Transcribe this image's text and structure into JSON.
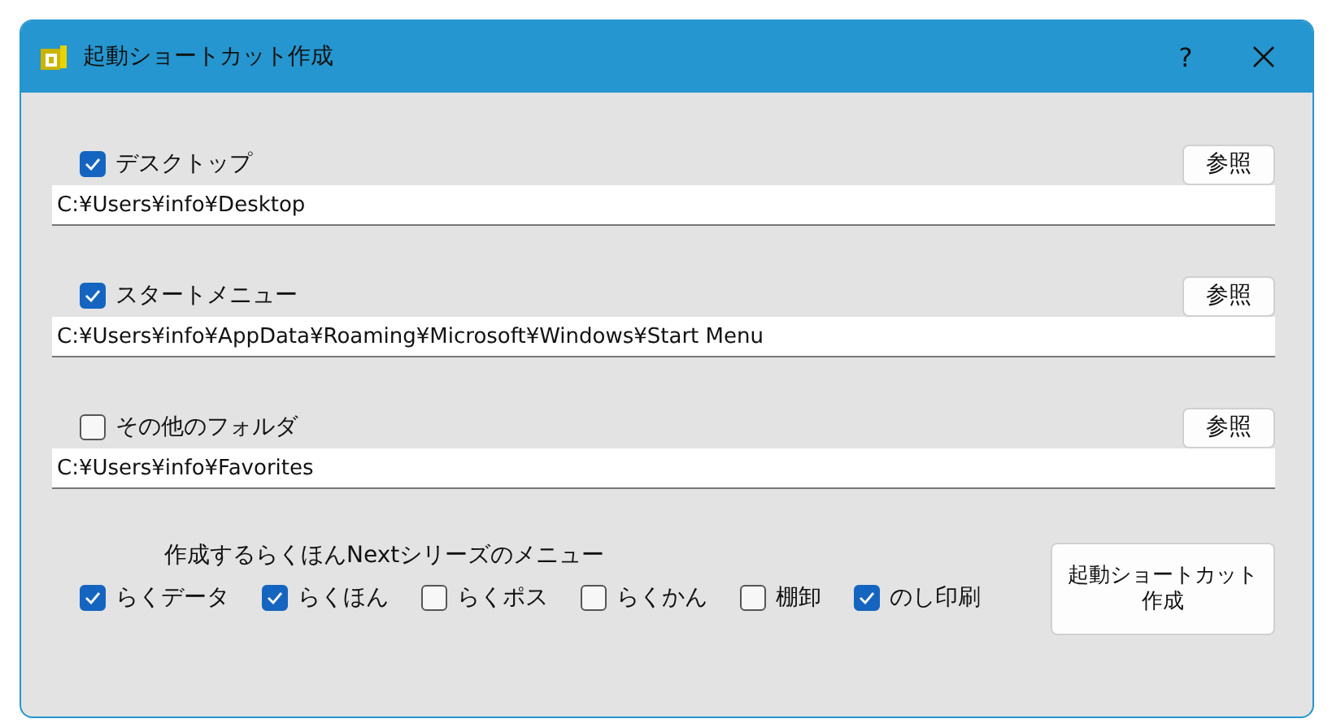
{
  "window": {
    "title": "起動ショートカット作成",
    "help": "?"
  },
  "folders": [
    {
      "label": "デスクトップ",
      "checked": true,
      "browse": "参照",
      "path": "C:¥Users¥info¥Desktop"
    },
    {
      "label": "スタートメニュー",
      "checked": true,
      "browse": "参照",
      "path": "C:¥Users¥info¥AppData¥Roaming¥Microsoft¥Windows¥Start Menu"
    },
    {
      "label": "その他のフォルダ",
      "checked": false,
      "browse": "参照",
      "path": "C:¥Users¥info¥Favorites"
    }
  ],
  "menu_group": {
    "label": "作成するらくほんNextシリーズのメニュー",
    "items": [
      {
        "label": "らくデータ",
        "checked": true
      },
      {
        "label": "らくほん",
        "checked": true
      },
      {
        "label": "らくポス",
        "checked": false
      },
      {
        "label": "らくかん",
        "checked": false
      },
      {
        "label": "棚卸",
        "checked": false
      },
      {
        "label": "のし印刷",
        "checked": true
      }
    ]
  },
  "create_button": "起動ショートカット作成"
}
